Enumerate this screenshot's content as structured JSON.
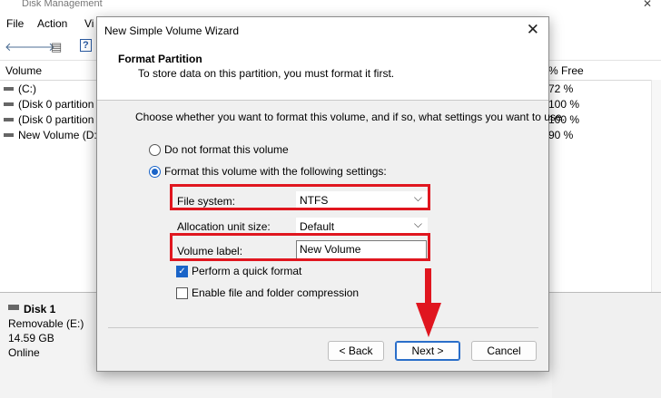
{
  "background_window": {
    "title": "Disk Management",
    "close_glyph": "✕",
    "menu": [
      "File",
      "Action",
      "Vi"
    ],
    "columns": {
      "volume": "Volume",
      "free_pct": "% Free"
    },
    "volumes": [
      {
        "name": "(C:)",
        "free": "72 %"
      },
      {
        "name": "(Disk 0 partition",
        "free": "100 %"
      },
      {
        "name": "(Disk 0 partition",
        "free": "100 %"
      },
      {
        "name": "New Volume (D:",
        "free": "90 %"
      }
    ],
    "disk": {
      "name": "Disk 1",
      "type": "Removable (E:)",
      "size": "14.59 GB",
      "status": "Online"
    }
  },
  "dialog": {
    "title": "New Simple Volume Wizard",
    "close_glyph": "✕",
    "header_title": "Format Partition",
    "header_subtitle": "To store data on this partition, you must format it first.",
    "intro": "Choose whether you want to format this volume, and if so, what settings you want to use.",
    "option_no_format": "Do not format this volume",
    "option_format": "Format this volume with the following settings:",
    "selected_option": "format",
    "file_system": {
      "label": "File system:",
      "value": "NTFS"
    },
    "allocation_unit_size": {
      "label": "Allocation unit size:",
      "value": "Default"
    },
    "volume_label": {
      "label": "Volume label:",
      "value": "New Volume"
    },
    "quick_format": {
      "label": "Perform a quick format",
      "checked": true
    },
    "compression": {
      "label": "Enable file and folder compression",
      "checked": false
    },
    "buttons": {
      "back": "< Back",
      "next": "Next >",
      "cancel": "Cancel"
    },
    "check_glyph": "✓",
    "chevron_glyph": "⌵"
  },
  "annotation_color": "#e0161f",
  "accent_color": "#1a64c8"
}
